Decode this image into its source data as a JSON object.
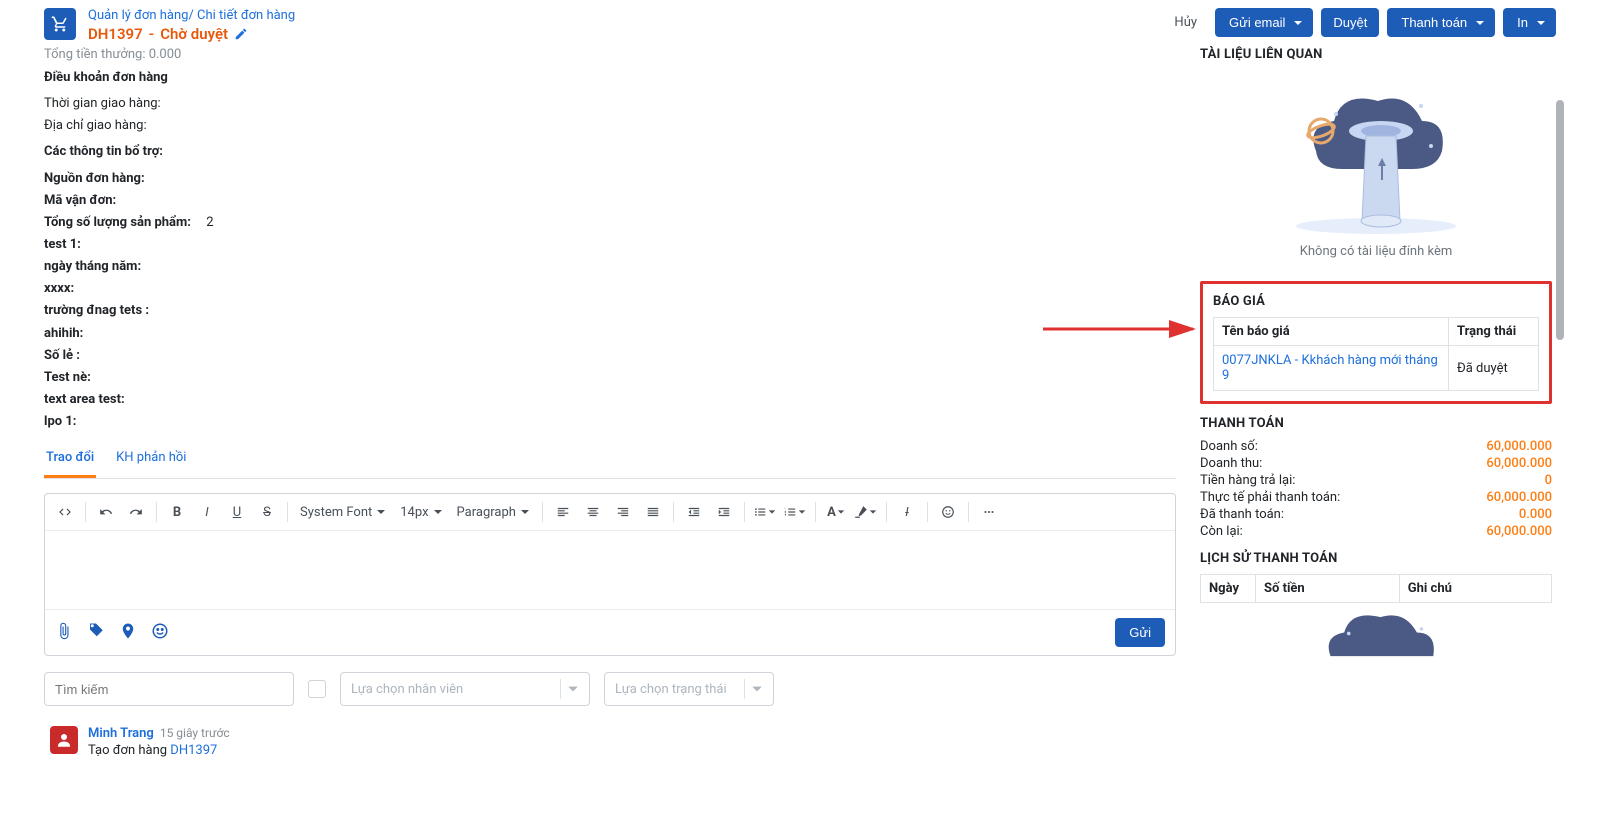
{
  "header": {
    "breadcrumb1": "Quản lý đơn hàng",
    "breadcrumb2": "Chi tiết đơn hàng",
    "order_code": "DH1397",
    "order_status": "Chờ duyệt",
    "actions": {
      "cancel": "Hủy",
      "email": "Gửi email",
      "approve": "Duyệt",
      "pay": "Thanh toán",
      "print": "In"
    }
  },
  "fields": {
    "bonus": "Tổng tiền thưởng: 0.000",
    "terms_title": "Điều khoản đơn hàng",
    "delivery_time_label": "Thời gian giao hàng:",
    "delivery_addr_label": "Địa chỉ giao hàng:",
    "extra_title": "Các thông tin bổ trợ:",
    "source_label": "Nguồn đơn hàng:",
    "tracking_label": "Mã vận đơn:",
    "qty_label": "Tổng số lượng sản phẩm:",
    "qty_value": "2",
    "test1": "test 1:",
    "date_label": "ngày tháng năm:",
    "xxxx": "xxxx:",
    "truong": "trường đnag tets :",
    "ahihih": "ahihih:",
    "sole": "Số lẻ :",
    "testne": "Test nè:",
    "textarea": "text area test:",
    "lpo": "lpo 1:"
  },
  "tabs": {
    "exchange": "Trao đổi",
    "feedback": "KH phản hồi"
  },
  "editor": {
    "font": "System Font",
    "size": "14px",
    "para": "Paragraph",
    "send": "Gửi"
  },
  "filters": {
    "search_ph": "Tìm kiếm",
    "employee_ph": "Lựa chọn nhân viên",
    "status_ph": "Lựa chọn trạng thái"
  },
  "activity": {
    "user": "Minh Trang",
    "time": "15 giây trước",
    "text_prefix": "Tạo đơn hàng ",
    "link": "DH1397"
  },
  "sidebar": {
    "docs_title": "TÀI LIỆU LIÊN QUAN",
    "docs_empty": "Không có tài liệu đính kèm",
    "quote_title": "BÁO GIÁ",
    "quote_col1": "Tên báo giá",
    "quote_col2": "Trạng thái",
    "quote_link": "0077JNKLA - Kkhách hàng mới tháng 9",
    "quote_status": "Đã duyệt",
    "payment_title": "THANH TOÁN",
    "pay_rows": [
      {
        "l": "Doanh số:",
        "v": "60,000.000"
      },
      {
        "l": "Doanh thu:",
        "v": "60,000.000"
      },
      {
        "l": "Tiền hàng trả lại:",
        "v": "0"
      },
      {
        "l": "Thực tế phải thanh toán:",
        "v": "60,000.000"
      },
      {
        "l": "Đã thanh toán:",
        "v": "0.000"
      },
      {
        "l": "Còn lại:",
        "v": "60,000.000"
      }
    ],
    "history_title": "LỊCH SỬ THANH TOÁN",
    "hist_col1": "Ngày",
    "hist_col2": "Số tiền",
    "hist_col3": "Ghi chú"
  }
}
